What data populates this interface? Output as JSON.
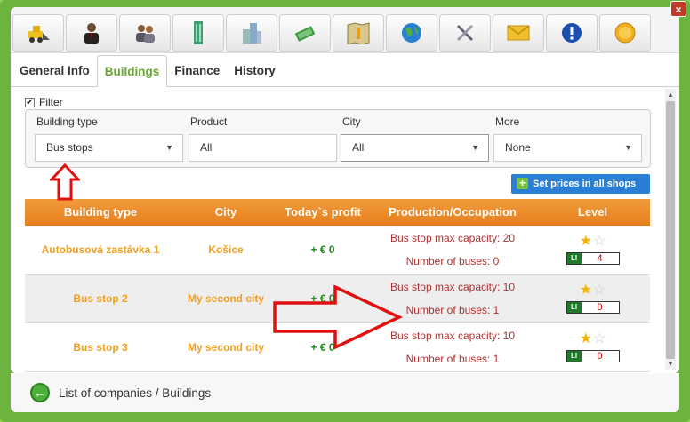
{
  "window": {
    "close_label": "×"
  },
  "toolbar": {
    "icons": [
      "bulldozer-icon",
      "businessman-icon",
      "employees-icon",
      "skyscraper-icon",
      "buildings-icon",
      "money-icon",
      "map-icon",
      "globe-icon",
      "tools-icon",
      "mail-icon",
      "info-icon",
      "coin-icon"
    ]
  },
  "tabs": [
    "General Info",
    "Buildings",
    "Finance",
    "History"
  ],
  "filter": {
    "label": "Filter",
    "checked": true,
    "fields": [
      {
        "label": "Building type",
        "value": "Bus stops"
      },
      {
        "label": "Product",
        "value": "All"
      },
      {
        "label": "City",
        "value": "All"
      },
      {
        "label": "More",
        "value": "None"
      }
    ]
  },
  "set_prices_label": "Set prices in all shops",
  "table": {
    "headers": [
      "Building type",
      "City",
      "Today`s profit",
      "Production/Occupation",
      "Level"
    ],
    "rows": [
      {
        "name": "Autobusová zastávka 1",
        "city": "Košice",
        "profit": "+ € 0",
        "capacity": "Bus stop max capacity: 20",
        "buses": "Number of buses: 0",
        "level": "4",
        "stars": 1
      },
      {
        "name": "Bus stop 2",
        "city": "My second city",
        "profit": "+ € 0",
        "capacity": "Bus stop max capacity: 10",
        "buses": "Number of buses: 1",
        "level": "0",
        "stars": 1
      },
      {
        "name": "Bus stop 3",
        "city": "My second city",
        "profit": "+ € 0",
        "capacity": "Bus stop max capacity: 10",
        "buses": "Number of buses: 1",
        "level": "0",
        "stars": 1
      }
    ]
  },
  "footer": {
    "breadcrumb": "List of companies / Buildings"
  },
  "level_tag": "LI"
}
